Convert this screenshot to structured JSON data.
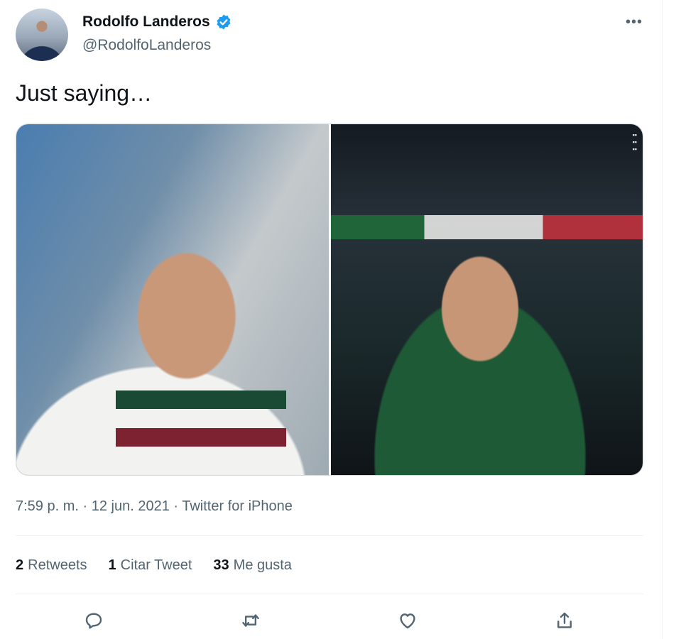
{
  "author": {
    "display_name": "Rodolfo Landeros",
    "handle": "@RodolfoLanderos",
    "verified": true,
    "avatar_icon": "profile-photo"
  },
  "tweet": {
    "text": "Just saying…",
    "time": "7:59 p. m.",
    "separator1": " · ",
    "date": "12 jun. 2021",
    "separator2": " · ",
    "source": "Twitter for iPhone"
  },
  "stats": {
    "retweets_count": "2",
    "retweets_label": "Retweets",
    "quotes_count": "1",
    "quotes_label": "Citar Tweet",
    "likes_count": "33",
    "likes_label": "Me gusta"
  },
  "actions": [
    "reply-icon",
    "retweet-icon",
    "like-icon",
    "share-icon"
  ],
  "colors": {
    "verified_blue": "#1d9bf0",
    "secondary_text": "#536471",
    "primary_text": "#0f1419",
    "divider": "#eff3f4"
  }
}
